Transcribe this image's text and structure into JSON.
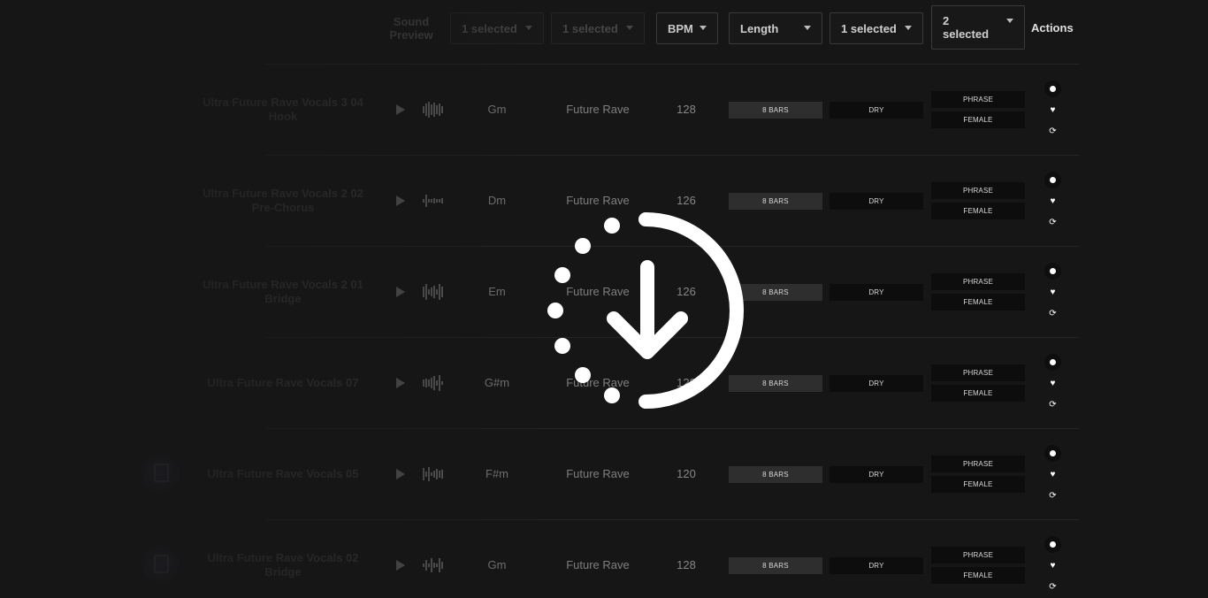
{
  "header": {
    "sound_preview": "Sound Preview",
    "filters": {
      "key": "1 selected",
      "genre": "1 selected",
      "bpm": "BPM",
      "length": "Length",
      "wet_dry": "1 selected",
      "tags": "2 selected"
    },
    "actions": "Actions"
  },
  "rows": [
    {
      "title": "Ultra Future Rave Vocals 3 04 Hook",
      "key": "Gm",
      "genre": "Future Rave",
      "bpm": "128",
      "length": "8 BARS",
      "type": "DRY",
      "tag1": "PHRASE",
      "tag2": "FEMALE"
    },
    {
      "title": "Ultra Future Rave Vocals 2 02 Pre-Chorus",
      "key": "Dm",
      "genre": "Future Rave",
      "bpm": "126",
      "length": "8 BARS",
      "type": "DRY",
      "tag1": "PHRASE",
      "tag2": "FEMALE"
    },
    {
      "title": "Ultra Future Rave Vocals 2 01 Bridge",
      "key": "Em",
      "genre": "Future Rave",
      "bpm": "126",
      "length": "8 BARS",
      "type": "DRY",
      "tag1": "PHRASE",
      "tag2": "FEMALE"
    },
    {
      "title": "Ultra Future Rave Vocals 07",
      "key": "G#m",
      "genre": "Future Rave",
      "bpm": "128",
      "length": "8 BARS",
      "type": "DRY",
      "tag1": "PHRASE",
      "tag2": "FEMALE"
    },
    {
      "title": "Ultra Future Rave Vocals 05",
      "key": "F#m",
      "genre": "Future Rave",
      "bpm": "120",
      "length": "8 BARS",
      "type": "DRY",
      "tag1": "PHRASE",
      "tag2": "FEMALE"
    },
    {
      "title": "Ultra Future Rave Vocals 02 Bridge",
      "key": "Gm",
      "genre": "Future Rave",
      "bpm": "128",
      "length": "8 BARS",
      "type": "DRY",
      "tag1": "PHRASE",
      "tag2": "FEMALE"
    }
  ],
  "icons": {
    "play": "play-icon",
    "waveform": "waveform-icon",
    "download": "download-icon",
    "favorite": "heart-icon",
    "similar": "refresh-icon",
    "overlay": "download-progress-icon"
  },
  "colors": {
    "background": "#161616",
    "tag_light": "#2e2e2e",
    "tag_dark": "#0d0d0d",
    "overlay_icon": "#ffffff"
  }
}
